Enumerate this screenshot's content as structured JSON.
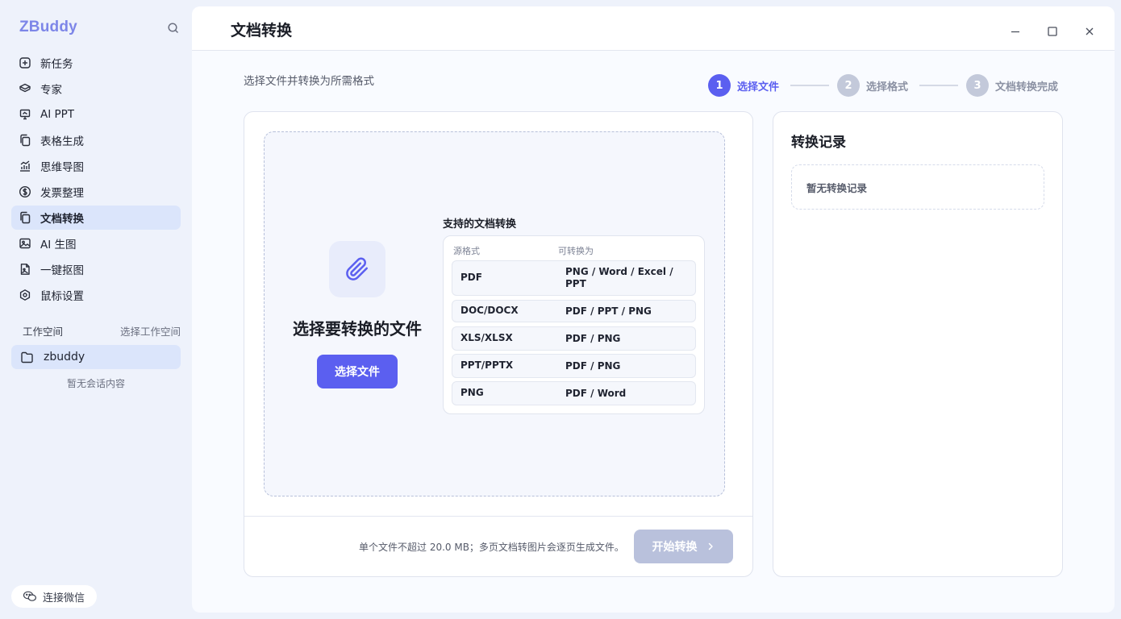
{
  "app": {
    "brand": "ZBuddy"
  },
  "sidebar": {
    "items": [
      {
        "label": "新任务",
        "icon": "plus-square-icon"
      },
      {
        "label": "专家",
        "icon": "layers-icon"
      },
      {
        "label": "AI PPT",
        "icon": "presentation-icon"
      },
      {
        "label": "表格生成",
        "icon": "copy-icon"
      },
      {
        "label": "思维导图",
        "icon": "chart-icon"
      },
      {
        "label": "发票整理",
        "icon": "dollar-icon"
      },
      {
        "label": "文档转换",
        "icon": "copy-icon",
        "active": true
      },
      {
        "label": "AI 生图",
        "icon": "image-icon"
      },
      {
        "label": "一键抠图",
        "icon": "file-image-icon"
      },
      {
        "label": "鼠标设置",
        "icon": "settings-icon"
      }
    ],
    "workspace": {
      "title": "工作空间",
      "select_label": "选择工作空间",
      "current": "zbuddy",
      "empty": "暂无会话内容"
    },
    "wechat_label": "连接微信"
  },
  "main": {
    "title": "文档转换",
    "subtitle": "选择文件并转换为所需格式",
    "steps": [
      {
        "num": "1",
        "label": "选择文件",
        "active": true
      },
      {
        "num": "2",
        "label": "选择格式",
        "active": false
      },
      {
        "num": "3",
        "label": "文档转换完成",
        "active": false
      }
    ],
    "upload": {
      "title": "选择要转换的文件",
      "button": "选择文件",
      "support_title": "支持的文档转换",
      "columns": [
        "源格式",
        "可转换为"
      ],
      "rows": [
        {
          "src": "PDF",
          "dst": "PNG / Word / Excel / PPT"
        },
        {
          "src": "DOC/DOCX",
          "dst": "PDF / PPT / PNG"
        },
        {
          "src": "XLS/XLSX",
          "dst": "PDF / PNG"
        },
        {
          "src": "PPT/PPTX",
          "dst": "PDF / PNG"
        },
        {
          "src": "PNG",
          "dst": "PDF / Word"
        }
      ],
      "note": "单个文件不超过 20.0 MB；多页文档转图片会逐页生成文件。",
      "start_button": "开始转换"
    },
    "history": {
      "title": "转换记录",
      "empty": "暂无转换记录"
    }
  },
  "colors": {
    "accent": "#5b5ff0",
    "brand": "#7d86e8",
    "disabled_button": "#b9c1dc"
  }
}
